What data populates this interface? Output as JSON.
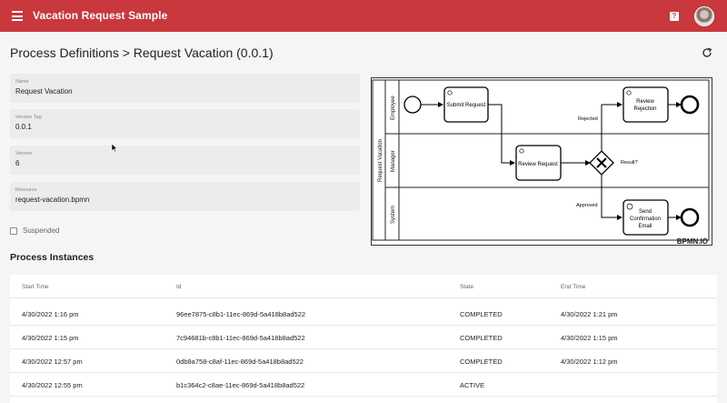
{
  "app": {
    "title": "Vacation Request Sample",
    "help_label": "?"
  },
  "header": {
    "title": "Process Definitions > Request Vacation (0.0.1)"
  },
  "fields": [
    {
      "label": "Name",
      "value": "Request Vacation"
    },
    {
      "label": "Version Tag",
      "value": "0.0.1"
    },
    {
      "label": "Version",
      "value": "6"
    },
    {
      "label": "Resource",
      "value": "request-vacation.bpmn"
    }
  ],
  "suspended_label": "Suspended",
  "diagram": {
    "pool": "Request Vacation",
    "lanes": [
      "Employee",
      "Manager",
      "System"
    ],
    "tasks": {
      "submit": "Submit Request",
      "review_request": "Review Request",
      "review_rejection_1": "Review",
      "review_rejection_2": "Rejection",
      "send_1": "Send",
      "send_2": "Confirmation",
      "send_3": "Email"
    },
    "gateway_label": "Result?",
    "flow_rejected": "Rejected",
    "flow_approved": "Approved",
    "watermark": "BPMN.IO"
  },
  "instances": {
    "title": "Process Instances",
    "columns": [
      "Start Time",
      "Id",
      "State",
      "End Time"
    ],
    "rows": [
      {
        "start": "4/30/2022 1:16 pm",
        "id": "96ee7875-c8b1-11ec-869d-5a418b8ad522",
        "state": "COMPLETED",
        "end": "4/30/2022 1:21 pm"
      },
      {
        "start": "4/30/2022 1:15 pm",
        "id": "7c94681b-c8b1-11ec-869d-5a418b8ad522",
        "state": "COMPLETED",
        "end": "4/30/2022 1:15 pm"
      },
      {
        "start": "4/30/2022 12:57 pm",
        "id": "0db8a758-c8af-11ec-869d-5a418b8ad522",
        "state": "COMPLETED",
        "end": "4/30/2022 1:12 pm"
      },
      {
        "start": "4/30/2022 12:55 pm",
        "id": "b1c364c2-c8ae-11ec-869d-5a418b8ad522",
        "state": "ACTIVE",
        "end": ""
      }
    ]
  }
}
